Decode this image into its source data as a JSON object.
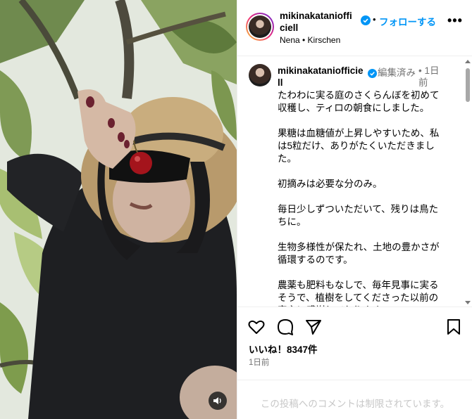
{
  "post": {
    "username": "mikinakataniofficiell",
    "follow_label": "フォローする",
    "separator": "•",
    "more_label": "•••",
    "audio": "Nena • Kirschen"
  },
  "caption": {
    "username": "mikinakataniofficiell",
    "edited_label": "編集済み",
    "time_label": "• 1日前",
    "text": "たわわに実る庭のさくらんぼを初めて収穫し、ティロの朝食にしました。\n\n果糖は血糖値が上昇しやすいため、私は5粒だけ、ありがたくいただきました。\n\n初摘みは必要な分のみ。\n\n毎日少しずついただいて、残りは鳥たちに。\n\n生物多様性が保たれ、土地の豊かさが循環するのです。\n\n農薬も肥料もなしで、毎年見事に実るそうで、植樹をしてくださった以前の家主に感謝しております。"
  },
  "actions": {
    "likes": "いいね！8347件",
    "time_ago": "1日前"
  },
  "comments": {
    "disabled_note": "この投稿へのコメントは制限されています。"
  },
  "icons": {
    "verified": "verified-badge-icon",
    "like": "heart-icon",
    "comment": "speech-bubble-icon",
    "share": "paper-plane-icon",
    "save": "bookmark-icon",
    "sound": "speaker-icon"
  },
  "colors": {
    "accent": "#0095f6",
    "muted": "#737373",
    "disabled": "#c7c7c7",
    "border": "#efefef"
  }
}
